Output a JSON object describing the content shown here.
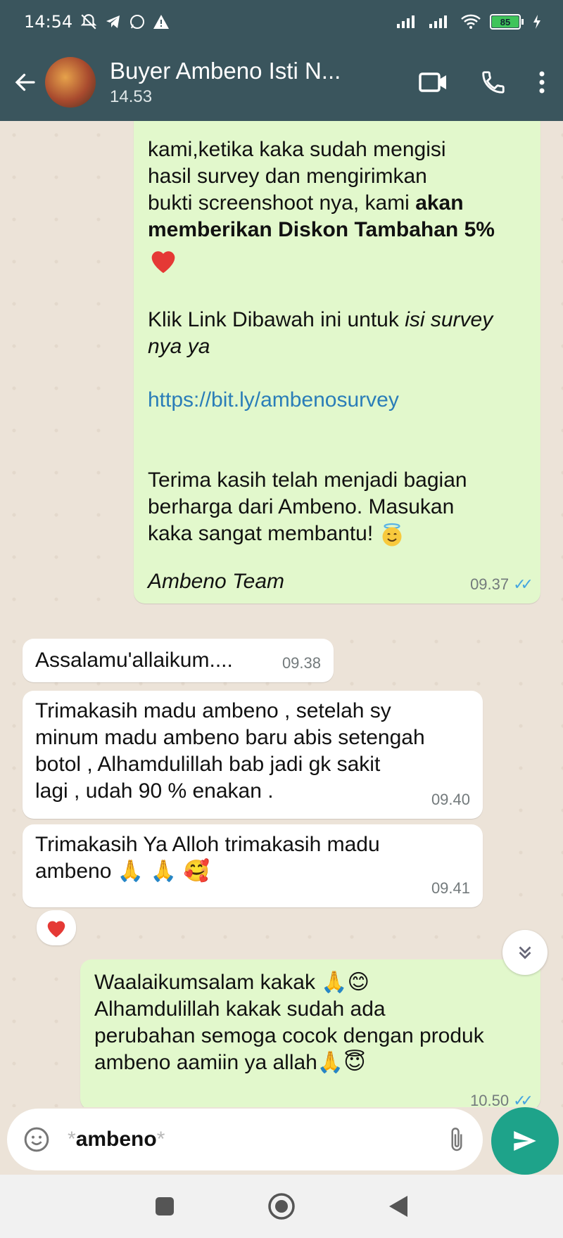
{
  "status_bar": {
    "time": "14:54",
    "battery": "85",
    "left_icons": [
      "mute-bell-icon",
      "telegram-icon",
      "whatsapp-icon",
      "warning-icon"
    ],
    "right_icons": [
      "signal-icon",
      "signal-icon",
      "wifi-icon",
      "battery-icon",
      "charging-icon"
    ]
  },
  "header": {
    "contact_name": "Buyer Ambeno Isti N...",
    "contact_status": "14.53",
    "actions": [
      "video-call-icon",
      "voice-call-icon",
      "more-icon"
    ]
  },
  "messages": [
    {
      "direction": "outgoing",
      "line1": "kami,ketika kaka sudah mengisi",
      "line2": "hasil survey dan mengirimkan",
      "line3_plain": "bukti screenshoot nya, kami ",
      "line3_bold": "akan",
      "line4_bold": "memberikan Diskon Tambahan 5%",
      "heart": "❤",
      "cta_plain": "Klik Link Dibawah ini untuk ",
      "cta_italic": "isi survey",
      "cta_italic2": "nya ya",
      "link": "https://bit.ly/ambenosurvey",
      "thanks1": "Terima kasih telah menjadi bagian",
      "thanks2": "berharga dari Ambeno. Masukan",
      "thanks3": "kaka sangat membantu! ",
      "thanks_emoji": "😇",
      "signature": "Ambeno Team",
      "time": "09.37",
      "ticks": "✓✓"
    },
    {
      "direction": "incoming",
      "text": "Assalamu'allaikum....",
      "time": "09.38"
    },
    {
      "direction": "incoming",
      "line1": "Trimakasih madu ambeno , setelah sy",
      "line2": "minum madu ambeno baru abis setengah",
      "line3": "botol , Alhamdulillah bab jadi gk sakit",
      "line4": "lagi , udah 90 % enakan .",
      "time": "09.40"
    },
    {
      "direction": "incoming",
      "line1": "Trimakasih Ya Alloh trimakasih madu",
      "line2": "ambeno ",
      "emojis": "🙏 🙏 🥰",
      "time": "09.41",
      "reaction": "❤"
    },
    {
      "direction": "outgoing",
      "line1": "Waalaikumsalam kakak ",
      "line1_emoji": "🙏😊",
      "line2": "Alhamdulillah kakak sudah ada",
      "line3": "perubahan semoga cocok dengan produk",
      "line4": "ambeno aamiin ya allah",
      "line4_emoji": "🙏😇",
      "time": "10.50",
      "ticks": "✓✓"
    }
  ],
  "input": {
    "text_star_open": "*",
    "text": "ambeno",
    "text_star_close": "*"
  },
  "nav": [
    "recent-apps-icon",
    "home-icon",
    "back-nav-icon"
  ]
}
